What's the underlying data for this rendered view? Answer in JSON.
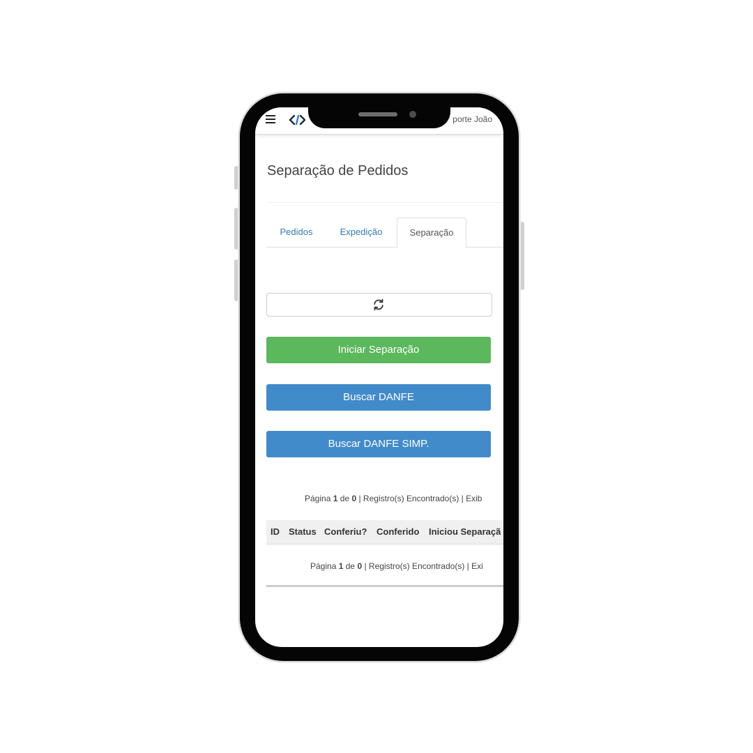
{
  "header": {
    "menu_icon": "hamburger-menu-icon",
    "logo_icon": "code-brackets-icon",
    "user_name": "porte João"
  },
  "page": {
    "title": "Separação de Pedidos"
  },
  "tabs": [
    {
      "label": "Pedidos",
      "active": false
    },
    {
      "label": "Expedição",
      "active": false
    },
    {
      "label": "Separação",
      "active": true
    }
  ],
  "actions": {
    "refresh_icon": "refresh-icon",
    "start_label": "Iniciar Separação",
    "start_color": "#5cb85c",
    "danfe_label": "Buscar DANFE",
    "danfe_color": "#428bca",
    "danfe_simp_label": "Buscar DANFE SIMP.",
    "danfe_simp_color": "#428bca"
  },
  "pagination": {
    "page_label": "Página",
    "current_page": "1",
    "of_label": "de",
    "total_pages": "0",
    "records_text": "| Registro(s) Encontrado(s) | Exib",
    "records_text_bottom": "| Registro(s) Encontrado(s) | Exi"
  },
  "table": {
    "columns": [
      "ID",
      "Status",
      "Conferiu?",
      "Conferido",
      "Iniciou Separaçã"
    ],
    "rows": []
  }
}
